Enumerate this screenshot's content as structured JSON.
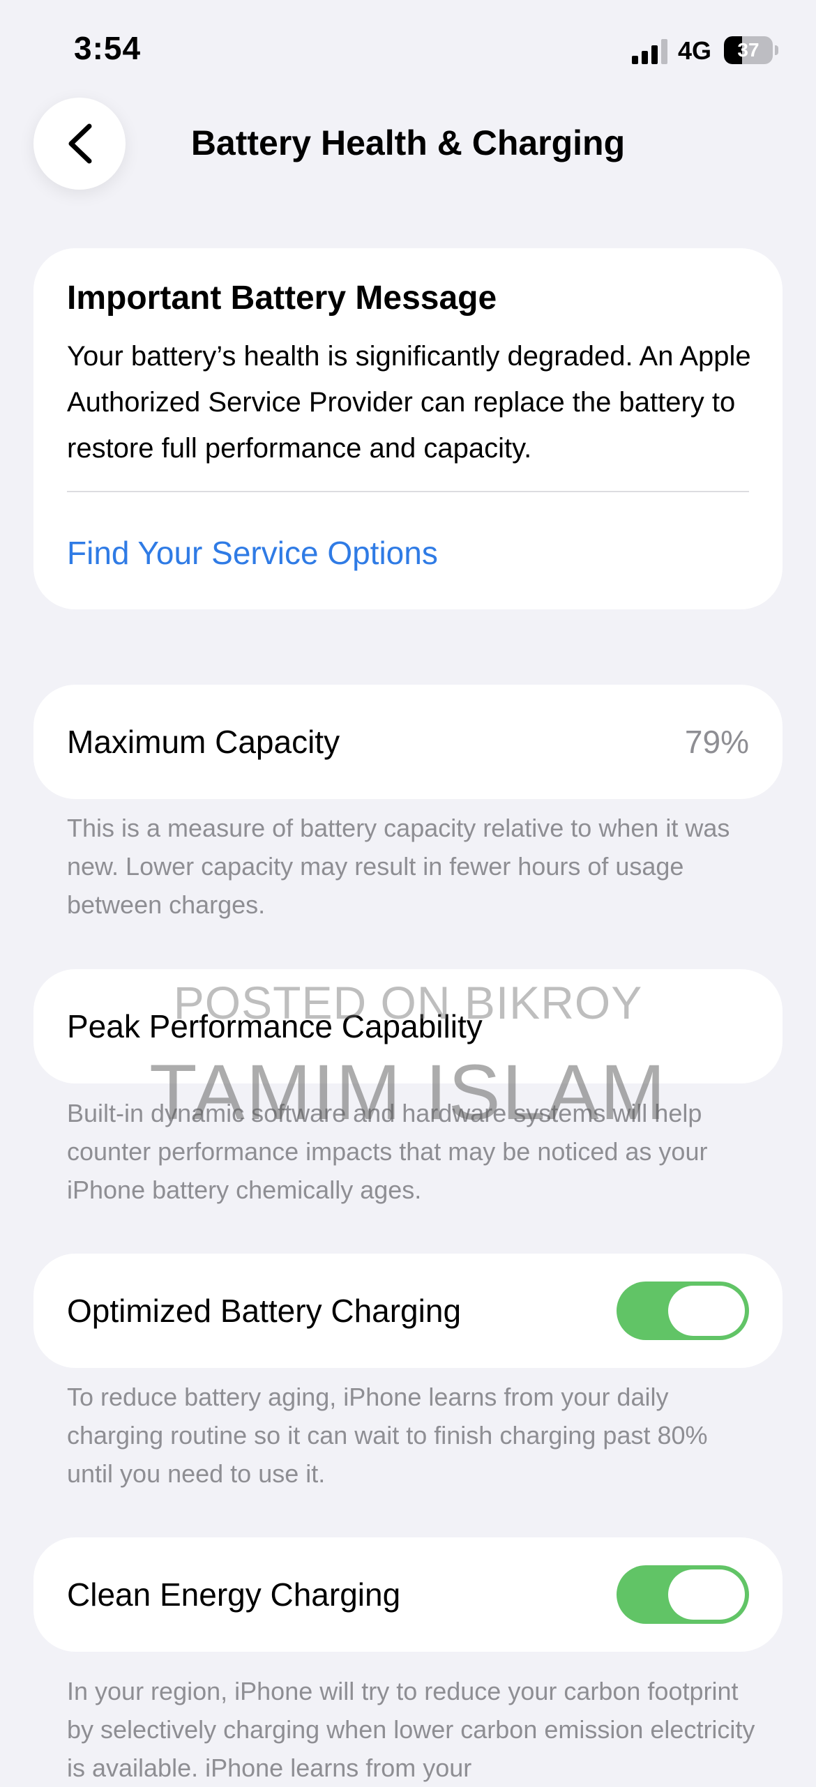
{
  "status_bar": {
    "time": "3:54",
    "network": "4G",
    "battery_percent": "37",
    "battery_level": 0.37
  },
  "nav": {
    "back_icon": "chevron-left-icon",
    "title": "Battery Health & Charging"
  },
  "battery_message": {
    "title": "Important Battery Message",
    "body": "Your battery’s health is significantly degraded. An Apple Authorized Service Provider can replace the battery to restore full performance and capacity.",
    "link": "Find Your Service Options",
    "link_color": "#2f7be5"
  },
  "maximum_capacity": {
    "label": "Maximum Capacity",
    "value": "79%",
    "footnote": "This is a measure of battery capacity relative to when it was new. Lower capacity may result in fewer hours of usage between charges."
  },
  "peak_performance": {
    "label": "Peak Performance Capability",
    "footnote": "Built-in dynamic software and hardware systems will help counter performance impacts that may be noticed as your iPhone battery chemically ages."
  },
  "optimized_charging": {
    "label": "Optimized Battery Charging",
    "enabled": true,
    "footnote": "To reduce battery aging, iPhone learns from your daily charging routine so it can wait to finish charging past 80% until you need to use it."
  },
  "clean_energy": {
    "label": "Clean Energy Charging",
    "enabled": true,
    "footnote": "In your region, iPhone will try to reduce your carbon footprint by selectively charging when lower carbon emission electricity is available. iPhone learns from your"
  },
  "watermark": {
    "line1": "POSTED ON BIKROY",
    "line2": "TAMIM ISLAM"
  },
  "colors": {
    "background": "#f2f2f7",
    "toggle_on": "#61c466",
    "secondary_text": "#8e8e93"
  }
}
